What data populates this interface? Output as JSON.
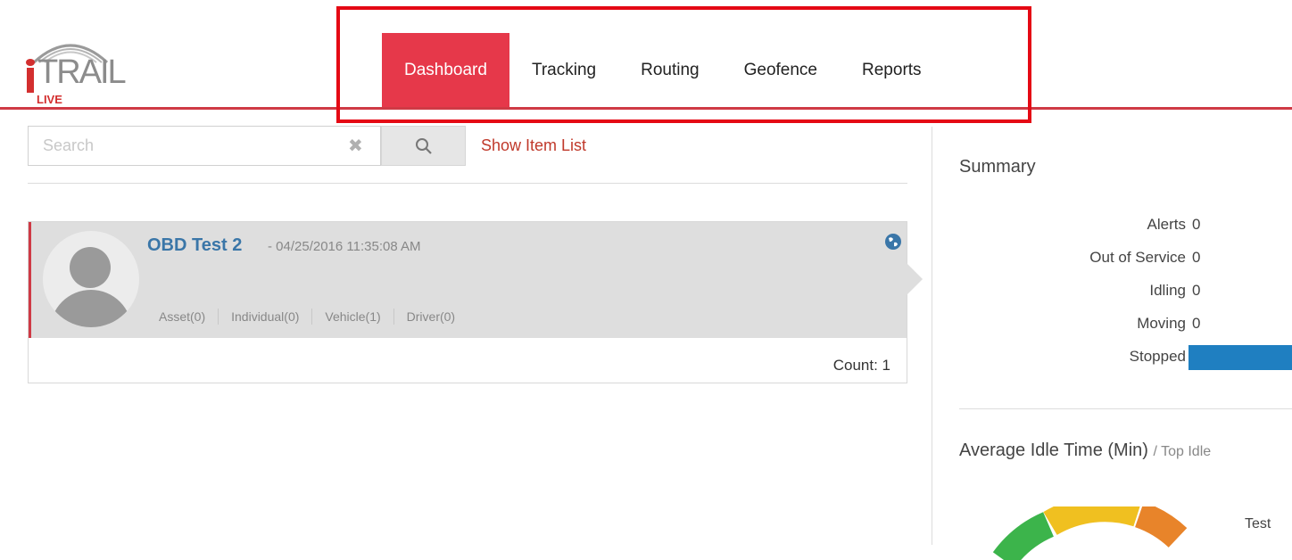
{
  "header": {
    "logo": {
      "main_text": "TRAIL",
      "sub_text": "LIVE"
    },
    "nav": [
      {
        "label": "Dashboard",
        "active": true
      },
      {
        "label": "Tracking",
        "active": false
      },
      {
        "label": "Routing",
        "active": false
      },
      {
        "label": "Geofence",
        "active": false
      },
      {
        "label": "Reports",
        "active": false
      }
    ],
    "accent_color": "#e6384a"
  },
  "search": {
    "placeholder": "Search",
    "value": "",
    "clear_icon": "close-icon",
    "search_icon": "search-icon",
    "show_list_label": "Show Item List"
  },
  "item": {
    "name": "OBD Test 2",
    "date": "- 04/25/2016 11:35:08 AM",
    "avatar_icon": "user-avatar-icon",
    "status_icon": "globe-icon",
    "categories": [
      "Asset(0)",
      "Individual(0)",
      "Vehicle(1)",
      "Driver(0)"
    ],
    "count": "Count: 1"
  },
  "summary": {
    "title": "Summary",
    "rows": [
      {
        "label": "Alerts",
        "value": "0"
      },
      {
        "label": "Out of Service",
        "value": "0"
      },
      {
        "label": "Idling",
        "value": "0"
      },
      {
        "label": "Moving",
        "value": "0"
      },
      {
        "label": "Stopped",
        "value": ""
      }
    ],
    "stopped_bar_color": "#1f7fc1"
  },
  "idle": {
    "title": "Average Idle Time (Min)",
    "subtitle": "/ Top Idle",
    "legend_label": "Test",
    "gauge_colors": [
      "#3cb44b",
      "#f0c020",
      "#e8842a"
    ]
  }
}
